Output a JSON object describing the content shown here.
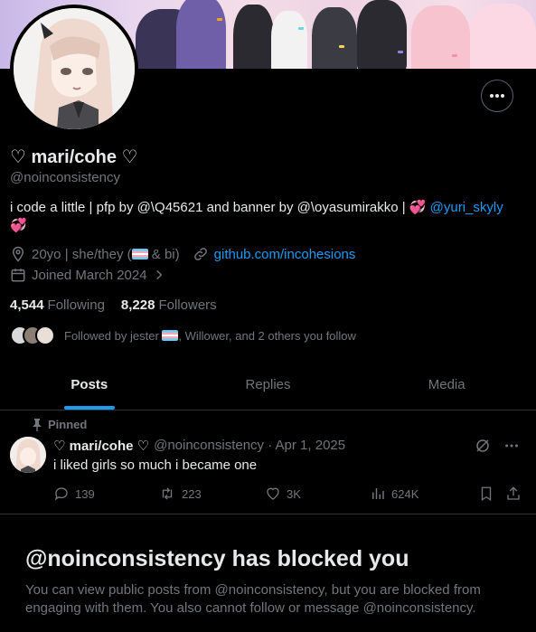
{
  "profile": {
    "name": "♡ mari/cohe ♡",
    "handle": "@noinconsistency",
    "bio_text": "i code a little | pfp by @\\Q45621 and banner by @\\oyasumirakko | 💞",
    "bio_link": "@yuri_skyly",
    "bio_tail": "💞",
    "location_pre": "20yo | she/they (",
    "location_post": " & bi)",
    "website": "github.com/incohesions",
    "joined": "Joined March 2024",
    "following_count": "4,544",
    "following_label": "Following",
    "followers_count": "8,228",
    "followers_label": "Followers",
    "followed_by_pre": "Followed by jester ",
    "followed_by_post": ", Willower, and 2 others you follow"
  },
  "tabs": [
    {
      "label": "Posts",
      "active": true
    },
    {
      "label": "Replies",
      "active": false
    },
    {
      "label": "Media",
      "active": false
    }
  ],
  "post": {
    "pinned_label": "Pinned",
    "author": "♡ mari/cohe ♡",
    "meta": "@noinconsistency · Apr 1, 2025",
    "text": "i liked girls so much i became one",
    "replies": "139",
    "reposts": "223",
    "likes": "3K",
    "views": "624K"
  },
  "blocked": {
    "title": "@noinconsistency has blocked you",
    "body": "You can view public posts from @noinconsistency, but you are blocked from engaging with them. You also cannot follow or message @noinconsistency."
  },
  "colors": {
    "background": "#000000",
    "text": "#e7e9ea",
    "muted": "#71767b",
    "accent": "#1d9bf0",
    "border": "#2f3336"
  },
  "icons": [
    "more-icon",
    "location-icon",
    "link-icon",
    "calendar-icon",
    "chevron-right-icon",
    "pin-icon",
    "reply-icon",
    "repost-icon",
    "like-icon",
    "views-icon",
    "bookmark-icon",
    "share-icon",
    "grok-icon"
  ]
}
